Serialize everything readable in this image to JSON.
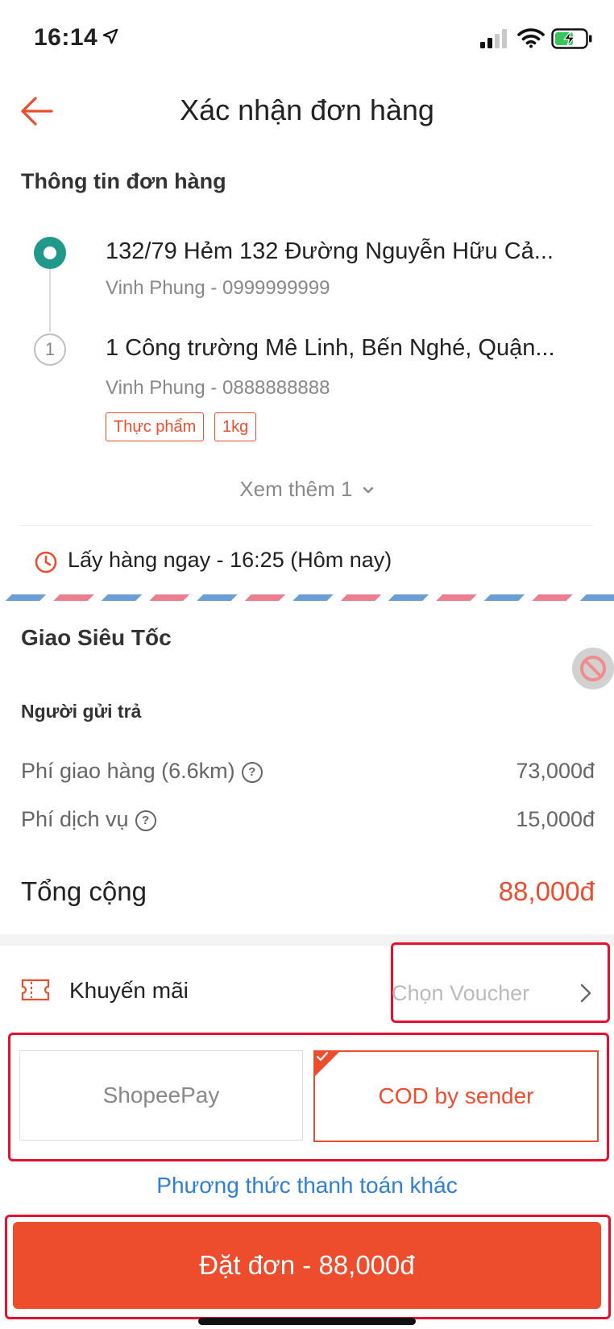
{
  "status_bar": {
    "time": "16:14"
  },
  "header": {
    "title": "Xác nhận đơn hàng"
  },
  "order_info": {
    "section_title": "Thông tin đơn hàng",
    "pickup": {
      "address": "132/79 Hẻm 132 Đường Nguyễn Hữu Cả...",
      "contact": "Vinh Phung - 0999999999"
    },
    "dropoff": {
      "index": "1",
      "address": "1 Công trường Mê Linh, Bến Nghé, Quận...",
      "contact": "Vinh Phung - 0888888888",
      "tags": [
        "Thực phẩm",
        "1kg"
      ]
    },
    "see_more": "Xem thêm 1",
    "pickup_time": "Lấy hàng ngay - 16:25 (Hôm nay)"
  },
  "service": {
    "name": "Giao Siêu Tốc",
    "payer": "Người gửi trả",
    "fees": [
      {
        "label": "Phí giao hàng (6.6km)",
        "value": "73,000đ"
      },
      {
        "label": "Phí dịch vụ",
        "value": "15,000đ"
      }
    ],
    "total_label": "Tổng cộng",
    "total_value": "88,000đ"
  },
  "promotion": {
    "label": "Khuyến mãi",
    "voucher_placeholder": "Chọn Voucher"
  },
  "payment": {
    "options": [
      {
        "label": "ShopeePay",
        "selected": false
      },
      {
        "label": "COD by sender",
        "selected": true
      }
    ],
    "other_methods": "Phương thức thanh toán khác"
  },
  "order_button": {
    "label": "Đặt đơn - 88,000đ"
  },
  "colors": {
    "brand": "#ee4d2d",
    "teal": "#21998a",
    "link": "#2f7ed8",
    "highlight_box": "#e8102e"
  },
  "icons": [
    "location-arrow-icon",
    "signal-icon",
    "wifi-icon",
    "battery-charging-icon",
    "back-arrow-icon",
    "clock-icon",
    "no-entry-icon",
    "help-icon",
    "ticket-icon",
    "chevron-right-icon",
    "checkmark-icon",
    "chevron-down-icon"
  ]
}
